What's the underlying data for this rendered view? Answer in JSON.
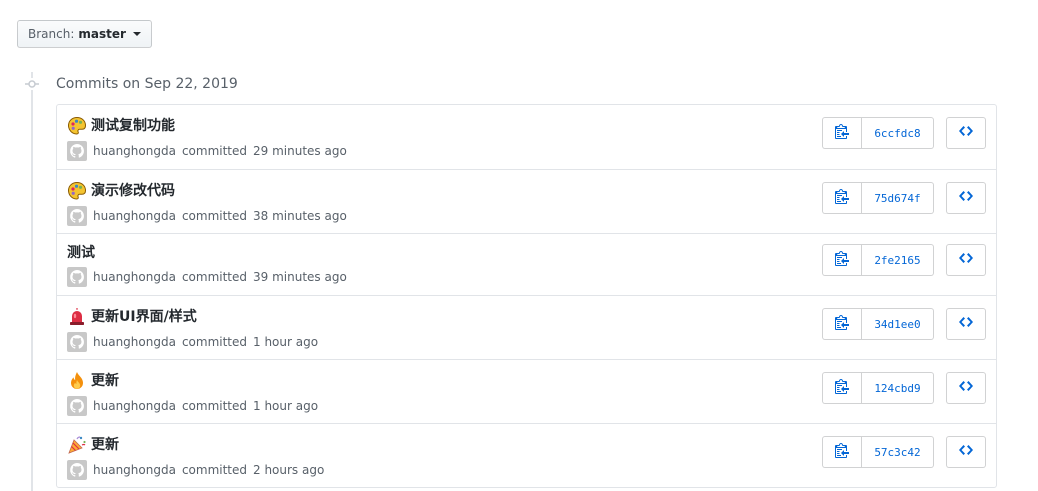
{
  "branch": {
    "prefix": "Branch:",
    "name": "master"
  },
  "group": {
    "title": "Commits on Sep 22, 2019"
  },
  "accent_color": "#0366d6",
  "commits": [
    {
      "title": "测试复制功能",
      "emoji": "art-palette-icon",
      "author": "huanghongda",
      "action": "committed",
      "time": "29 minutes ago",
      "sha": "6ccfdc8"
    },
    {
      "title": "演示修改代码",
      "emoji": "art-palette-icon",
      "author": "huanghongda",
      "action": "committed",
      "time": "38 minutes ago",
      "sha": "75d674f"
    },
    {
      "title": "测试",
      "emoji": "",
      "author": "huanghongda",
      "action": "committed",
      "time": "39 minutes ago",
      "sha": "2fe2165"
    },
    {
      "title": "更新UI界面/样式",
      "emoji": "rotating-light-icon",
      "author": "huanghongda",
      "action": "committed",
      "time": "1 hour ago",
      "sha": "34d1ee0"
    },
    {
      "title": "更新",
      "emoji": "fire-icon",
      "author": "huanghongda",
      "action": "committed",
      "time": "1 hour ago",
      "sha": "124cbd9"
    },
    {
      "title": "更新",
      "emoji": "tada-icon",
      "author": "huanghongda",
      "action": "committed",
      "time": "2 hours ago",
      "sha": "57c3c42"
    }
  ]
}
